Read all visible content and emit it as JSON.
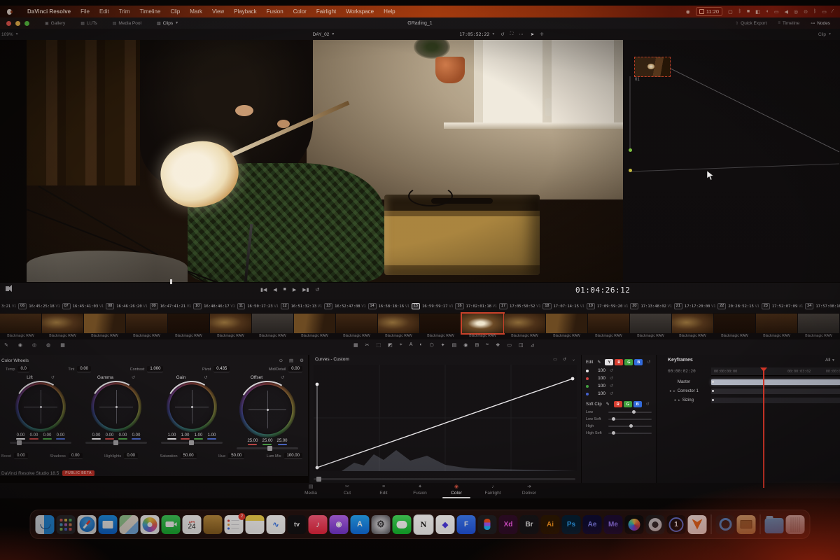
{
  "window": {
    "title": "GRading_1"
  },
  "menu_bar": {
    "items": [
      "DaVinci Resolve",
      "File",
      "Edit",
      "Trim",
      "Timeline",
      "Clip",
      "Mark",
      "View",
      "Playback",
      "Fusion",
      "Color",
      "Fairlight",
      "Workspace",
      "Help"
    ],
    "time": "11:20",
    "status_icons": [
      "screen-record-icon",
      "display-icon",
      "bluetooth-icon",
      "focus-icon",
      "photos-icon",
      "video-icon",
      "monitor-icon",
      "volume-icon",
      "time-machine-icon",
      "control-center-icon",
      "battery-icon",
      "spotlight-icon"
    ]
  },
  "app_toolbar": {
    "gallery": "Gallery",
    "luts": "LUTs",
    "media_pool": "Media Pool",
    "clips": "Clips",
    "quick_export": "Quick Export",
    "timeline_menu": "Timeline",
    "nodes": "Nodes"
  },
  "viewer": {
    "zoom": "109%",
    "timeline_name": "DAY_02",
    "clip_timecode": "17:05:52:22",
    "mode": "Clip"
  },
  "node_graph": {
    "node_label": "01"
  },
  "transport": {
    "master_timecode": "01:04:26:12"
  },
  "timeline": {
    "track": "V1",
    "partial_timecode": "3:21",
    "selected_clip": "15",
    "clips": [
      {
        "num": "06",
        "tc": "16:45:25:18"
      },
      {
        "num": "07",
        "tc": "16:45:41:03"
      },
      {
        "num": "08",
        "tc": "16:46:26:20"
      },
      {
        "num": "09",
        "tc": "16:47:41:21"
      },
      {
        "num": "10",
        "tc": "16:48:46:17"
      },
      {
        "num": "11",
        "tc": "16:50:17:23"
      },
      {
        "num": "12",
        "tc": "16:51:32:13"
      },
      {
        "num": "13",
        "tc": "16:52:47:08"
      },
      {
        "num": "14",
        "tc": "16:58:18:16"
      },
      {
        "num": "15",
        "tc": "16:59:59:17"
      },
      {
        "num": "16",
        "tc": "17:02:01:18"
      },
      {
        "num": "17",
        "tc": "17:05:50:52"
      },
      {
        "num": "18",
        "tc": "17:07:14:15"
      },
      {
        "num": "19",
        "tc": "17:09:59:20"
      },
      {
        "num": "20",
        "tc": "17:13:48:02"
      },
      {
        "num": "21",
        "tc": "17:17:20:00"
      },
      {
        "num": "22",
        "tc": "20:28:52:15"
      },
      {
        "num": "23",
        "tc": "17:52:07:09"
      },
      {
        "num": "24",
        "tc": "17:57:08:16"
      }
    ],
    "clip_format_label": "Blackmagic RAW",
    "thumb_count": 20,
    "selected_thumb_index": 11
  },
  "color_wheels": {
    "header": "Color Wheels",
    "top_controls": [
      [
        "Temp",
        "0.0"
      ],
      [
        "Tint",
        "0.00"
      ],
      [
        "Contrast",
        "1.000"
      ],
      [
        "Pivot",
        "0.435"
      ],
      [
        "Mid/Detail",
        "0.00"
      ]
    ],
    "wheels": [
      {
        "name": "Lift",
        "values": [
          "0.00",
          "0.00",
          "0.00",
          "0.00"
        ],
        "slider": 12
      },
      {
        "name": "Gamma",
        "values": [
          "0.00",
          "0.00",
          "0.00",
          "0.00"
        ],
        "slider": 46
      },
      {
        "name": "Gain",
        "values": [
          "1.00",
          "1.00",
          "1.00",
          "1.00"
        ],
        "slider": 46
      },
      {
        "name": "Offset",
        "values": [
          "25.00",
          "25.00",
          "25.00"
        ],
        "slider": 50
      }
    ],
    "bottom_controls": [
      [
        "Boost",
        "0.00"
      ],
      [
        "Shadows",
        "0.00"
      ],
      [
        "Highlights",
        "0.00"
      ],
      [
        "Saturation",
        "50.00"
      ],
      [
        "Hue",
        "50.00"
      ],
      [
        "Lum Mix",
        "100.00"
      ]
    ]
  },
  "curves": {
    "header": "Curves - Custom"
  },
  "curve_controls": {
    "edit_label": "Edit",
    "channels": [
      "Y",
      "R",
      "G",
      "B"
    ],
    "channel_values": [
      "100",
      "100",
      "100",
      "100"
    ],
    "soft_clip_label": "Soft Clip",
    "soft_clip_channels": [
      "R",
      "G",
      "B"
    ],
    "soft_clip_params": [
      "Low",
      "Low Soft",
      "High",
      "High Soft"
    ]
  },
  "keyframes": {
    "header": "Keyframes",
    "filter": "All",
    "current_timecode": "00:00:02:20",
    "ruler_ticks": [
      "00:00:00:00",
      "00:00:03:02",
      "00:00:0"
    ],
    "tracks": [
      "Master",
      "Corrector 1",
      "Sizing"
    ]
  },
  "status_bar": {
    "version": "DaVinci Resolve Studio 18.5",
    "badge": "PUBLIC BETA"
  },
  "page_tabs": {
    "tabs": [
      "Media",
      "Cut",
      "Edit",
      "Fusion",
      "Color",
      "Fairlight",
      "Deliver"
    ],
    "active": "Color"
  },
  "dock": {
    "apps": [
      "finder",
      "launchpad",
      "safari",
      "mail",
      "maps",
      "photos",
      "facetime",
      "calendar",
      "contacts",
      "reminders",
      "notes",
      "freeform",
      "apple-tv",
      "music",
      "podcasts",
      "app-store",
      "system-settings",
      "messages",
      "notion",
      "craft",
      "framer",
      "figma",
      "adobe-xd",
      "adobe-bridge",
      "adobe-illustrator",
      "adobe-photoshop",
      "adobe-after-effects",
      "adobe-media-encoder",
      "davinci-resolve",
      "compressor",
      "capture-one",
      "fox",
      "quicktime",
      "unarchiver",
      "downloads",
      "trash"
    ],
    "dividers_after": [
      "fox",
      "unarchiver"
    ],
    "badges": {
      "reminders": "2"
    },
    "letters": {
      "apple-tv": "tv",
      "notion": "N",
      "capture-one": "1",
      "adobe-xd": "Xd",
      "adobe-bridge": "Br",
      "adobe-illustrator": "Ai",
      "adobe-photoshop": "Ps",
      "adobe-after-effects": "Ae",
      "adobe-media-encoder": "Me",
      "calendar": "24",
      "calendar_month": "APR",
      "app-store": "A",
      "framer": "F",
      "freeform": "∿",
      "craft": "◆",
      "music": "♪",
      "podcasts": "◉",
      "system-settings": "⚙"
    }
  },
  "colors": {
    "accent_red": "#e0382a",
    "selection_red": "#c8402a",
    "button_red": "#d63c30",
    "button_green": "#3da33d",
    "button_blue": "#2e6be0",
    "master_track": "#b9c0cf",
    "menu_bar_tint": "#b4400f"
  }
}
